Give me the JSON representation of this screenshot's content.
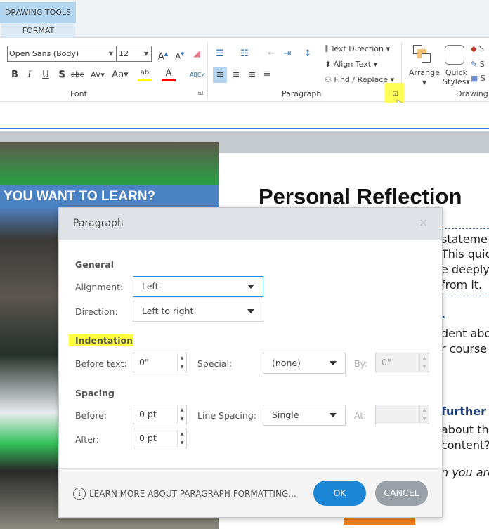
{
  "ribbon": {
    "context_tab": "DRAWING TOOLS",
    "active_tab": "FORMAT",
    "font": {
      "name": "Open Sans (Body)",
      "size": "12",
      "group_label": "Font"
    },
    "paragraph": {
      "group_label": "Paragraph",
      "text_direction": "Text Direction",
      "align_text": "Align Text",
      "find_replace": "Find / Replace"
    },
    "drawing": {
      "group_label": "Drawing",
      "arrange": "Arrange",
      "quick_styles_1": "Quick",
      "quick_styles_2": "Styles",
      "shape_items": [
        "S",
        "S",
        "S"
      ]
    },
    "highlight_color": "#ffff00",
    "font_color": "#ff0000"
  },
  "document": {
    "banner": "YOU WANT TO LEARN?",
    "title": "Personal Reflection",
    "snippets": [
      "statemе",
      "This quick",
      "e deeply",
      "from it.",
      ".",
      "dent abou",
      "r course",
      "further is",
      "about thi",
      "content?",
      "n you are"
    ]
  },
  "dialog": {
    "title": "Paragraph",
    "close": "×",
    "general": {
      "heading": "General",
      "alignment_label": "Alignment:",
      "alignment_value": "Left",
      "direction_label": "Direction:",
      "direction_value": "Left to right"
    },
    "indentation": {
      "heading": "Indentation",
      "before_label": "Before text:",
      "before_value": "0\"",
      "special_label": "Special:",
      "special_value": "(none)",
      "by_label": "By:",
      "by_value": "0\""
    },
    "spacing": {
      "heading": "Spacing",
      "before_label": "Before:",
      "before_value": "0 pt",
      "after_label": "After:",
      "after_value": "0 pt",
      "line_label": "Line Spacing:",
      "line_value": "Single",
      "at_label": "At:",
      "at_value": ""
    },
    "learn_more": "LEARN MORE ABOUT PARAGRAPH FORMATTING...",
    "ok": "OK",
    "cancel": "CANCEL"
  }
}
